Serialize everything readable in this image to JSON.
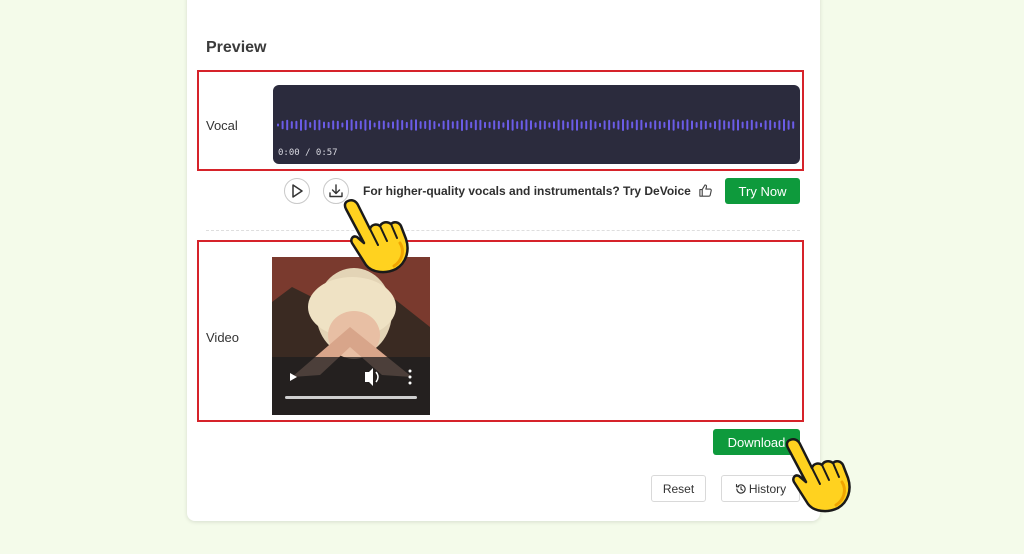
{
  "preview": {
    "title": "Preview",
    "vocal_label": "Vocal",
    "vocal_time": "0:00 / 0:57",
    "promo_text": "For higher-quality vocals and instrumentals? Try DeVoice",
    "try_now_label": "Try Now",
    "video_label": "Video",
    "download_label": "Download",
    "reset_label": "Reset",
    "history_label": "History"
  },
  "colors": {
    "accent_green": "#0e9a3c",
    "waveform": "#6b5ce7",
    "highlight_red": "#d6232a"
  },
  "icons": {
    "play": "play-icon",
    "download": "download-icon",
    "thumbs_up": "thumbs-up-icon",
    "history": "history-icon",
    "pointer": "pointing-hand-icon"
  }
}
